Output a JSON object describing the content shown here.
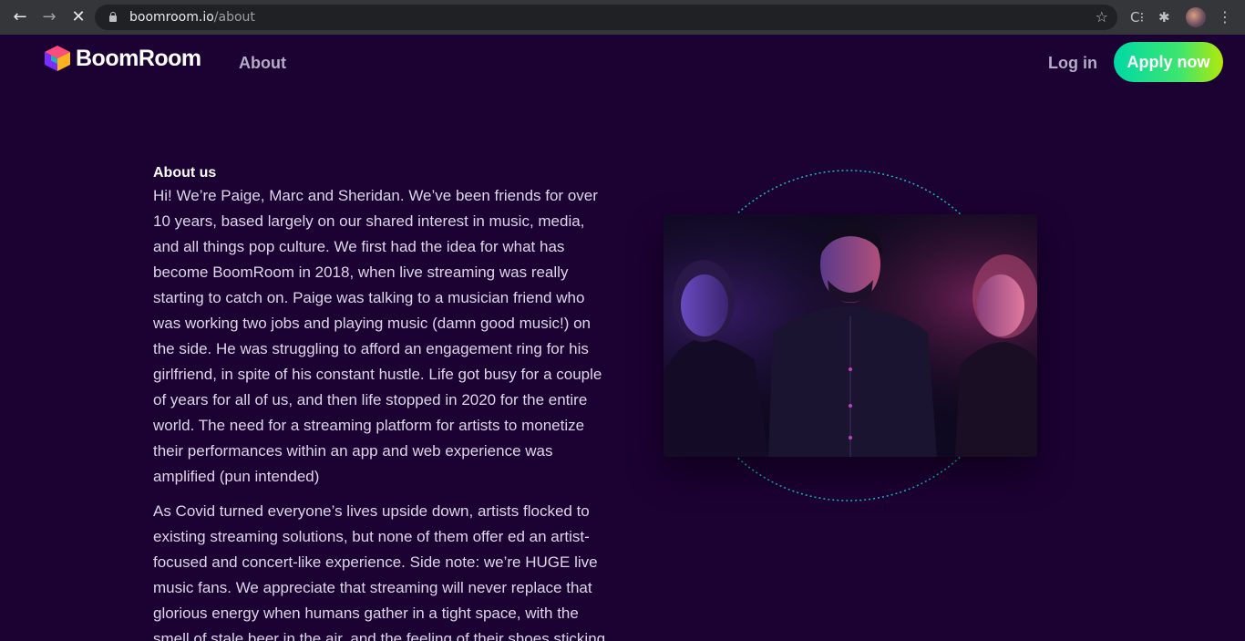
{
  "browser": {
    "url_domain": "boomroom.io",
    "url_path": "/about",
    "back_glyph": "←",
    "forward_glyph": "→",
    "stop_glyph": "✕",
    "star_glyph": "☆",
    "ext_glyph": "C⁝",
    "puzzle_glyph": "✱",
    "menu_glyph": "⋮"
  },
  "header": {
    "brand": "BoomRoom",
    "nav_about": "About",
    "login": "Log in",
    "apply": "Apply now"
  },
  "about": {
    "title": "About us",
    "paragraph1": "Hi! We’re Paige, Marc and Sheridan. We’ve been friends for over 10 years, based largely on our shared interest in music, media, and all things pop culture. We first had the idea for what has become BoomRoom in 2018, when live streaming was really starting to catch on. Paige was talking to a musician friend who was working two jobs and playing music (damn good music!) on the side. He was struggling to afford an engagement ring for his girlfriend, in spite of his constant hustle. Life got busy for a couple of years for all of us, and then life stopped in 2020 for the entire world. The need for a streaming platform for artists to monetize their performances within an app and web experience was amplified (pun intended)",
    "paragraph2": "As Covid turned everyone’s lives upside down, artists flocked to existing streaming solutions, but none of them offer ed an artist-focused and concert-like experience. Side note: we’re HUGE live music fans. We appreciate that streaming will never replace that glorious energy when humans gather in a tight space, with the smell of stale beer in the air, and the feeling of their shoes sticking"
  },
  "colors": {
    "background": "#1c0133",
    "accent_start": "#00d9a6",
    "accent_end": "#b4e80a",
    "ring": "#1fb6c9"
  },
  "icons": [
    "back-arrow-icon",
    "forward-arrow-icon",
    "stop-icon",
    "lock-icon",
    "star-icon",
    "extension-icon",
    "puzzle-icon",
    "menu-icon",
    "boomroom-logo-icon"
  ]
}
